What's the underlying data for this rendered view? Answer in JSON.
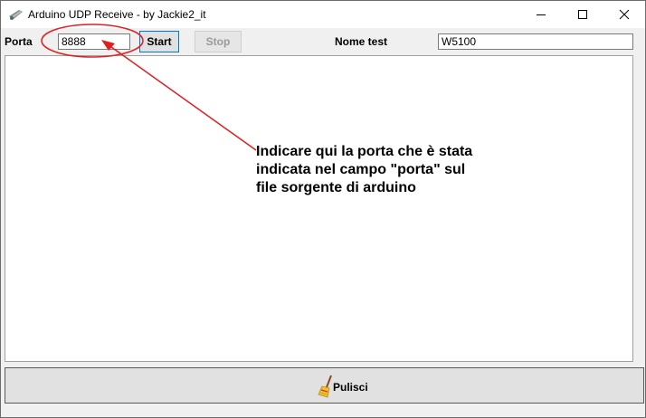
{
  "window": {
    "title": "Arduino UDP Receive - by Jackie2_it",
    "icons": {
      "app": "arduino-app-icon",
      "minimize": "minimize-icon",
      "maximize": "maximize-icon",
      "close": "close-icon"
    }
  },
  "toolbar": {
    "porta_label": "Porta",
    "porta_value": "8888",
    "start_label": "Start",
    "stop_label": "Stop",
    "nome_test_label": "Nome test",
    "nome_test_value": "W5100"
  },
  "log": {
    "content": ""
  },
  "footer": {
    "pulisci_label": "Pulisci",
    "icon": "broom-icon"
  },
  "annotation": {
    "color": "#e02020",
    "lines": [
      "Indicare qui la porta che è stata",
      "indicata nel campo \"porta\" sul",
      "file sorgente di arduino"
    ]
  }
}
